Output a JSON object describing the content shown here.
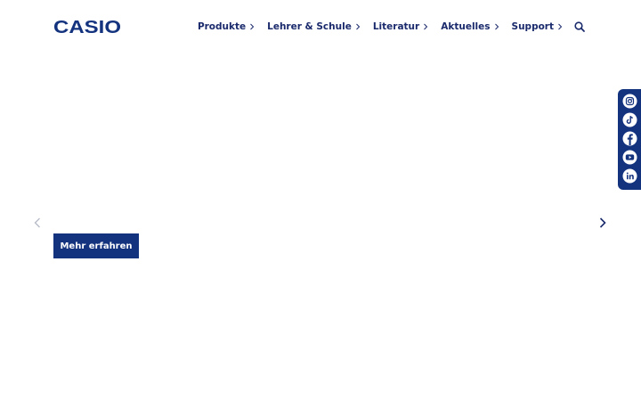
{
  "brand": {
    "name": "CASIO",
    "color": "#14337f"
  },
  "nav": {
    "items": [
      {
        "label": "Produkte"
      },
      {
        "label": "Lehrer & Schule"
      },
      {
        "label": "Literatur"
      },
      {
        "label": "Aktuelles"
      },
      {
        "label": "Support"
      }
    ],
    "search_icon": "search-icon"
  },
  "carousel": {
    "prev_icon": "chevron-left-icon",
    "next_icon": "chevron-right-icon",
    "cta_label": "Mehr erfahren"
  },
  "social": {
    "items": [
      {
        "icon": "instagram-icon"
      },
      {
        "icon": "tiktok-icon"
      },
      {
        "icon": "facebook-icon"
      },
      {
        "icon": "youtube-icon"
      },
      {
        "icon": "linkedin-icon"
      }
    ]
  }
}
